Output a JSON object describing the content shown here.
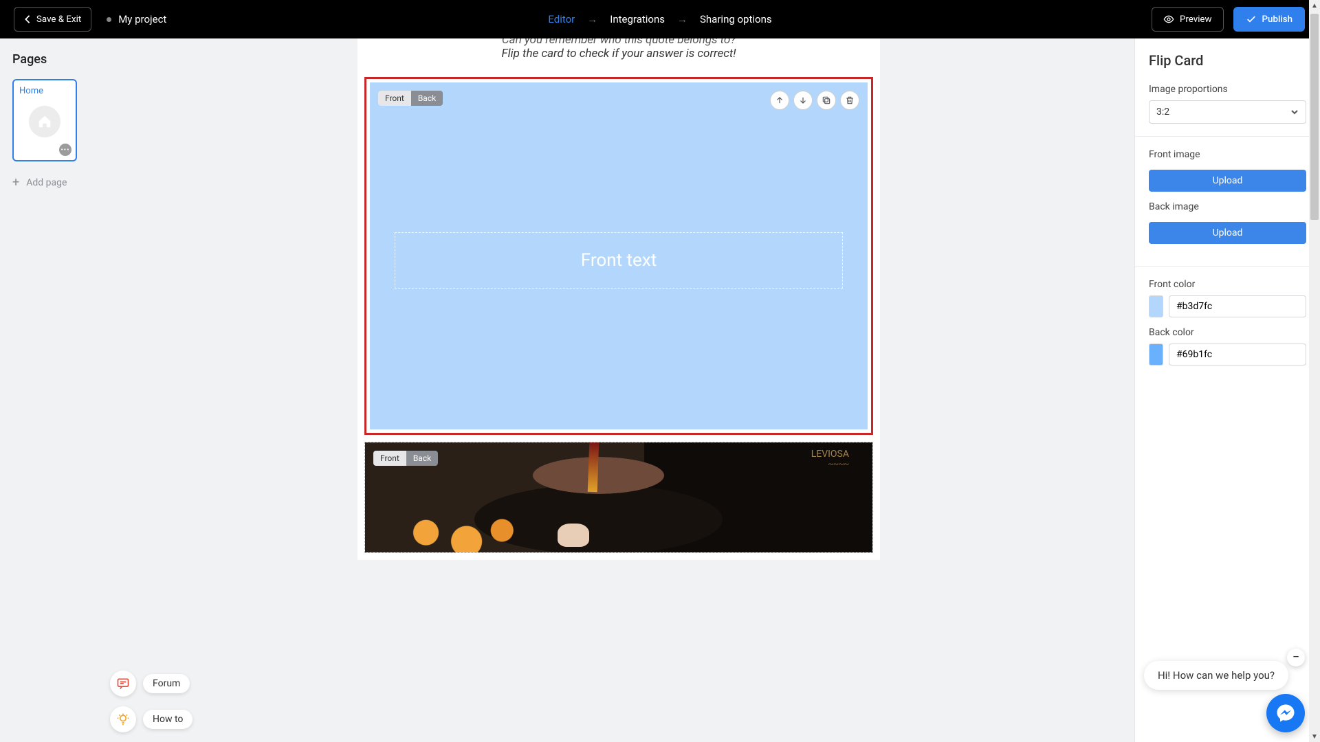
{
  "header": {
    "save_exit": "Save & Exit",
    "project_name": "My project",
    "steps": {
      "editor": "Editor",
      "integrations": "Integrations",
      "sharing": "Sharing options"
    },
    "preview": "Preview",
    "publish": "Publish"
  },
  "left": {
    "title": "Pages",
    "home_page_label": "Home",
    "add_page": "Add page"
  },
  "canvas": {
    "intro_line1": "Can you remember who this quote belongs to?",
    "intro_line2": "Flip the card to check if your answer is correct!",
    "toggle_front": "Front",
    "toggle_back": "Back",
    "front_text_placeholder": "Front text",
    "photo_scrawl": "LEVIOSA"
  },
  "right": {
    "title": "Flip Card",
    "proportions_label": "Image proportions",
    "proportions_value": "3:2",
    "front_image_label": "Front image",
    "back_image_label": "Back image",
    "upload_label": "Upload",
    "front_color_label": "Front color",
    "front_color_value": "#b3d7fc",
    "back_color_label": "Back color",
    "back_color_value": "#69b1fc"
  },
  "help": {
    "forum": "Forum",
    "howto": "How to",
    "chat_greeting": "Hi! How can we help you?"
  }
}
